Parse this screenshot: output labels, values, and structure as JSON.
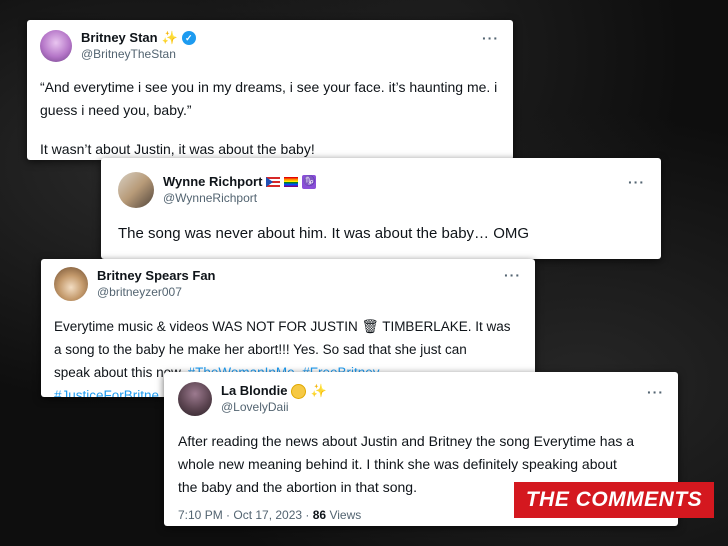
{
  "tweet1": {
    "name": "Britney Stan",
    "handle": "@BritneyTheStan",
    "line1": "“And everytime i see you in my dreams, i see your face. it’s haunting me. i",
    "line2": "guess i need you, baby.”",
    "line3": "It wasn’t about Justin, it was about the baby!",
    "more": "···"
  },
  "tweet2": {
    "name": "Wynne Richport",
    "handle": "@WynneRichport",
    "badge": "♑",
    "text": "The song was never about him. It was about the baby… OMG",
    "more": "···"
  },
  "tweet3": {
    "name": "Britney Spears Fan",
    "handle": "@britneyzer007",
    "line1": "Everytime music & videos WAS NOT FOR JUSTIN 🗑 TIMBERLAKE. It was",
    "line2": "a song to the baby he make her abort!!! Yes. So sad that she just can",
    "line3_text": "speak about this now.",
    "hashtag1": "#TheWomanInMe",
    "hashtag2": "#FreeBritney",
    "hashtag3": "#JusticeForBritne",
    "more": "···"
  },
  "tweet4": {
    "name": "La Blondie",
    "handle": "@LovelyDaii",
    "line1": "After reading the news about Justin and Britney the song Everytime has a",
    "line2": "whole new meaning behind it. I think she was definitely speaking about",
    "line3": "the baby and the abortion in that song.",
    "timestamp": "7:10 PM · Oct 17, 2023 ·",
    "views_count": "86",
    "views_label": "Views",
    "more": "···"
  },
  "banner": {
    "label": "THE COMMENTS"
  },
  "colors": {
    "link": "#1d9bf0",
    "banner": "#d4181f",
    "verified": "#1d9bf0"
  }
}
